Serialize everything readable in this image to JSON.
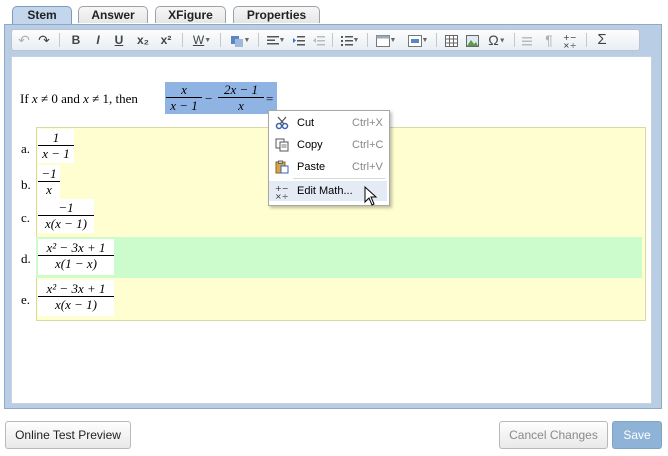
{
  "tabs": [
    {
      "label": "Stem",
      "active": true
    },
    {
      "label": "Answer",
      "active": false
    },
    {
      "label": "XFigure",
      "active": false
    },
    {
      "label": "Properties",
      "active": false
    }
  ],
  "toolbar": {
    "undo": "↶",
    "redo": "↷",
    "bold": "B",
    "italic": "I",
    "underline": "U",
    "subscript": "x₂",
    "superscript": "x²",
    "word": "W",
    "omega": "Ω",
    "pilcrow": "¶",
    "sigma": "Σ"
  },
  "question": {
    "prefix": "If",
    "x1": "x",
    "neq": "≠",
    "zero": "0",
    "and": "and",
    "x2": "x",
    "one": "1,",
    "then": "then",
    "frac1_num": "x",
    "frac1_den": "x − 1",
    "minus": "−",
    "frac2_num": "2x − 1",
    "frac2_den": "x",
    "equals": "="
  },
  "answers": [
    {
      "label": "a.",
      "num": "1",
      "den": "x − 1"
    },
    {
      "label": "b.",
      "num": "−1",
      "den": "x"
    },
    {
      "label": "c.",
      "num": "−1",
      "den": "x(x − 1)"
    },
    {
      "label": "d.",
      "num": "x² − 3x + 1",
      "den": "x(1 − x)",
      "correct": true
    },
    {
      "label": "e.",
      "num": "x² − 3x + 1",
      "den": "x(x − 1)"
    }
  ],
  "context_menu": {
    "items": [
      {
        "label": "Cut",
        "shortcut": "Ctrl+X",
        "icon": "scissors-icon"
      },
      {
        "label": "Copy",
        "shortcut": "Ctrl+C",
        "icon": "copy-icon"
      },
      {
        "label": "Paste",
        "shortcut": "Ctrl+V",
        "icon": "paste-icon"
      },
      {
        "label": "Edit Math...",
        "shortcut": "",
        "icon": "math-edit-icon"
      }
    ]
  },
  "footer": {
    "preview_label": "Online Test Preview",
    "cancel_label": "Cancel Changes",
    "save_label": "Save"
  },
  "colors": {
    "selection": "#8fb4e4",
    "answer_bg": "#fefed0",
    "correct_bg": "#ccfccc",
    "save_bg": "#8fb3d6"
  }
}
